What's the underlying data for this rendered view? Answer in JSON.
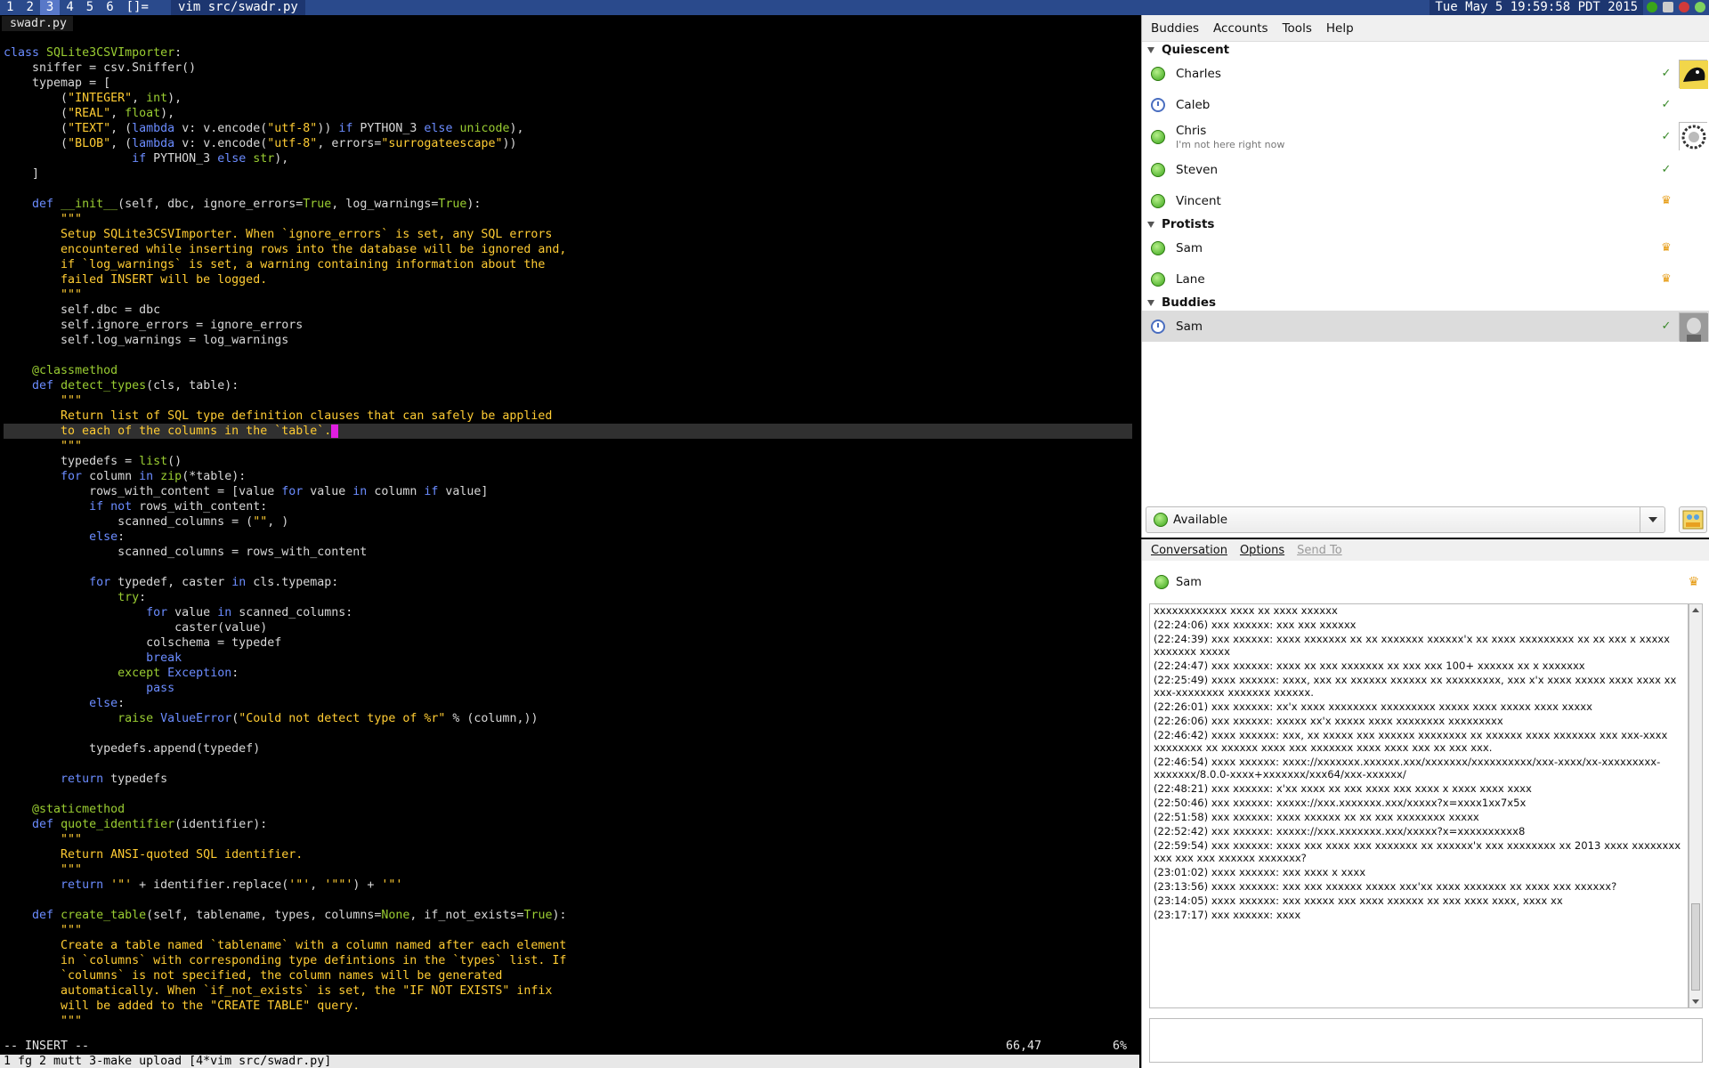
{
  "topbar": {
    "tags": [
      "1",
      "2",
      "3",
      "4",
      "5",
      "6",
      "[]="
    ],
    "active_tag": "3",
    "window_title": "vim src/swadr.py",
    "clock": "Tue May  5 19:59:58 PDT 2015"
  },
  "vim": {
    "filename": "swadr.py",
    "mode": "-- INSERT --",
    "position": "66,47",
    "percent": "6%",
    "tmux": "1 fg 2 mutt 3-make upload [4*vim src/swadr.py]",
    "cursor_line": 25,
    "lines": [
      [
        [
          "k",
          "class "
        ],
        [
          "b",
          "SQLite3CSVImporter"
        ],
        [
          "n",
          ":"
        ]
      ],
      [
        [
          "n",
          "    sniffer = csv.Sniffer()"
        ]
      ],
      [
        [
          "n",
          "    typemap = ["
        ]
      ],
      [
        [
          "n",
          "        ("
        ],
        [
          "s",
          "\"INTEGER\""
        ],
        [
          "n",
          ", "
        ],
        [
          "b",
          "int"
        ],
        [
          "n",
          "),"
        ]
      ],
      [
        [
          "n",
          "        ("
        ],
        [
          "s",
          "\"REAL\""
        ],
        [
          "n",
          ", "
        ],
        [
          "b",
          "float"
        ],
        [
          "n",
          "),"
        ]
      ],
      [
        [
          "n",
          "        ("
        ],
        [
          "s",
          "\"TEXT\""
        ],
        [
          "n",
          ", ("
        ],
        [
          "k",
          "lambda"
        ],
        [
          "n",
          " v: v.encode("
        ],
        [
          "s",
          "\"utf-8\""
        ],
        [
          "n",
          ")) "
        ],
        [
          "k",
          "if"
        ],
        [
          "n",
          " PYTHON_3 "
        ],
        [
          "k",
          "else"
        ],
        [
          "n",
          " "
        ],
        [
          "b",
          "unicode"
        ],
        [
          "n",
          "),"
        ]
      ],
      [
        [
          "n",
          "        ("
        ],
        [
          "s",
          "\"BLOB\""
        ],
        [
          "n",
          ", ("
        ],
        [
          "k",
          "lambda"
        ],
        [
          "n",
          " v: v.encode("
        ],
        [
          "s",
          "\"utf-8\""
        ],
        [
          "n",
          ", errors="
        ],
        [
          "s",
          "\"surrogateescape\""
        ],
        [
          "n",
          "))"
        ]
      ],
      [
        [
          "n",
          "                  "
        ],
        [
          "k",
          "if"
        ],
        [
          "n",
          " PYTHON_3 "
        ],
        [
          "k",
          "else"
        ],
        [
          "n",
          " "
        ],
        [
          "b",
          "str"
        ],
        [
          "n",
          "),"
        ]
      ],
      [
        [
          "n",
          "    ]"
        ]
      ],
      [
        [
          "n",
          ""
        ]
      ],
      [
        [
          "n",
          "    "
        ],
        [
          "k",
          "def"
        ],
        [
          "n",
          " "
        ],
        [
          "b",
          "__init__"
        ],
        [
          "n",
          "(self, dbc, ignore_errors="
        ],
        [
          "b",
          "True"
        ],
        [
          "n",
          ", log_warnings="
        ],
        [
          "b",
          "True"
        ],
        [
          "n",
          "):"
        ]
      ],
      [
        [
          "s",
          "        \"\"\""
        ]
      ],
      [
        [
          "s",
          "        Setup SQLite3CSVImporter. When `ignore_errors` is set, any SQL errors"
        ]
      ],
      [
        [
          "s",
          "        encountered while inserting rows into the database will be ignored and,"
        ]
      ],
      [
        [
          "s",
          "        if `log_warnings` is set, a warning containing information about the"
        ]
      ],
      [
        [
          "s",
          "        failed INSERT will be logged."
        ]
      ],
      [
        [
          "s",
          "        \"\"\""
        ]
      ],
      [
        [
          "n",
          "        self.dbc = dbc"
        ]
      ],
      [
        [
          "n",
          "        self.ignore_errors = ignore_errors"
        ]
      ],
      [
        [
          "n",
          "        self.log_warnings = log_warnings"
        ]
      ],
      [
        [
          "n",
          ""
        ]
      ],
      [
        [
          "n",
          "    "
        ],
        [
          "d",
          "@classmethod"
        ]
      ],
      [
        [
          "n",
          "    "
        ],
        [
          "k",
          "def"
        ],
        [
          "n",
          " "
        ],
        [
          "b",
          "detect_types"
        ],
        [
          "n",
          "(cls, table):"
        ]
      ],
      [
        [
          "s",
          "        \"\"\""
        ]
      ],
      [
        [
          "s",
          "        Return list of SQL type definition clauses that can safely be applied"
        ]
      ],
      [
        [
          "s",
          "        to each of the columns in the `table`."
        ]
      ],
      [
        [
          "s",
          "        \"\"\""
        ]
      ],
      [
        [
          "n",
          "        typedefs = "
        ],
        [
          "b",
          "list"
        ],
        [
          "n",
          "()"
        ]
      ],
      [
        [
          "n",
          "        "
        ],
        [
          "k",
          "for"
        ],
        [
          "n",
          " column "
        ],
        [
          "k",
          "in"
        ],
        [
          "n",
          " "
        ],
        [
          "b",
          "zip"
        ],
        [
          "n",
          "(*table):"
        ]
      ],
      [
        [
          "n",
          "            rows_with_content = [value "
        ],
        [
          "k",
          "for"
        ],
        [
          "n",
          " value "
        ],
        [
          "k",
          "in"
        ],
        [
          "n",
          " column "
        ],
        [
          "k",
          "if"
        ],
        [
          "n",
          " value]"
        ]
      ],
      [
        [
          "n",
          "            "
        ],
        [
          "k",
          "if not"
        ],
        [
          "n",
          " rows_with_content:"
        ]
      ],
      [
        [
          "n",
          "                scanned_columns = ("
        ],
        [
          "s",
          "\"\""
        ],
        [
          "n",
          ", )"
        ]
      ],
      [
        [
          "n",
          "            "
        ],
        [
          "k",
          "else"
        ],
        [
          "n",
          ":"
        ]
      ],
      [
        [
          "n",
          "                scanned_columns = rows_with_content"
        ]
      ],
      [
        [
          "n",
          ""
        ]
      ],
      [
        [
          "n",
          "            "
        ],
        [
          "k",
          "for"
        ],
        [
          "n",
          " typedef, caster "
        ],
        [
          "k",
          "in"
        ],
        [
          "n",
          " cls.typemap:"
        ]
      ],
      [
        [
          "n",
          "                "
        ],
        [
          "b",
          "try"
        ],
        [
          "n",
          ":"
        ]
      ],
      [
        [
          "n",
          "                    "
        ],
        [
          "k",
          "for"
        ],
        [
          "n",
          " value "
        ],
        [
          "k",
          "in"
        ],
        [
          "n",
          " scanned_columns:"
        ]
      ],
      [
        [
          "n",
          "                        caster(value)"
        ]
      ],
      [
        [
          "n",
          "                    colschema = typedef"
        ]
      ],
      [
        [
          "n",
          "                    "
        ],
        [
          "k",
          "break"
        ]
      ],
      [
        [
          "n",
          "                "
        ],
        [
          "b",
          "except"
        ],
        [
          "n",
          " "
        ],
        [
          "k",
          "Exception"
        ],
        [
          "n",
          ":"
        ]
      ],
      [
        [
          "n",
          "                    "
        ],
        [
          "k",
          "pass"
        ]
      ],
      [
        [
          "n",
          "            "
        ],
        [
          "k",
          "else"
        ],
        [
          "n",
          ":"
        ]
      ],
      [
        [
          "n",
          "                "
        ],
        [
          "b",
          "raise"
        ],
        [
          "n",
          " "
        ],
        [
          "k",
          "ValueError"
        ],
        [
          "n",
          "("
        ],
        [
          "s",
          "\"Could not detect type of %r\""
        ],
        [
          "n",
          " % (column,))"
        ]
      ],
      [
        [
          "n",
          ""
        ]
      ],
      [
        [
          "n",
          "            typedefs.append(typedef)"
        ]
      ],
      [
        [
          "n",
          ""
        ]
      ],
      [
        [
          "n",
          "        "
        ],
        [
          "k",
          "return"
        ],
        [
          "n",
          " typedefs"
        ]
      ],
      [
        [
          "n",
          ""
        ]
      ],
      [
        [
          "n",
          "    "
        ],
        [
          "d",
          "@staticmethod"
        ]
      ],
      [
        [
          "n",
          "    "
        ],
        [
          "k",
          "def"
        ],
        [
          "n",
          " "
        ],
        [
          "b",
          "quote_identifier"
        ],
        [
          "n",
          "(identifier):"
        ]
      ],
      [
        [
          "s",
          "        \"\"\""
        ]
      ],
      [
        [
          "s",
          "        Return ANSI-quoted SQL identifier."
        ]
      ],
      [
        [
          "s",
          "        \"\"\""
        ]
      ],
      [
        [
          "n",
          "        "
        ],
        [
          "k",
          "return"
        ],
        [
          "n",
          " "
        ],
        [
          "s",
          "'\"'"
        ],
        [
          "n",
          " + identifier.replace("
        ],
        [
          "s",
          "'\"'"
        ],
        [
          "n",
          ", "
        ],
        [
          "s",
          "'\"\"'"
        ],
        [
          "n",
          ") + "
        ],
        [
          "s",
          "'\"'"
        ]
      ],
      [
        [
          "n",
          ""
        ]
      ],
      [
        [
          "n",
          "    "
        ],
        [
          "k",
          "def"
        ],
        [
          "n",
          " "
        ],
        [
          "b",
          "create_table"
        ],
        [
          "n",
          "(self, tablename, types, columns="
        ],
        [
          "b",
          "None"
        ],
        [
          "n",
          ", if_not_exists="
        ],
        [
          "b",
          "True"
        ],
        [
          "n",
          "):"
        ]
      ],
      [
        [
          "s",
          "        \"\"\""
        ]
      ],
      [
        [
          "s",
          "        Create a table named `tablename` with a column named after each element"
        ]
      ],
      [
        [
          "s",
          "        in `columns` with corresponding type defintions in the `types` list. If"
        ]
      ],
      [
        [
          "s",
          "        `columns` is not specified, the column names will be generated"
        ]
      ],
      [
        [
          "s",
          "        automatically. When `if_not_exists` is set, the \"IF NOT EXISTS\" infix"
        ]
      ],
      [
        [
          "s",
          "        will be added to the \"CREATE TABLE\" query."
        ]
      ],
      [
        [
          "s",
          "        \"\"\""
        ]
      ]
    ]
  },
  "buddy_list": {
    "menu": [
      "Buddies",
      "Accounts",
      "Tools",
      "Help"
    ],
    "groups": [
      {
        "name": "Quiescent",
        "buddies": [
          {
            "name": "Charles",
            "status": "available",
            "protocol": "gtalk-icon",
            "avatar": "charles"
          },
          {
            "name": "Caleb",
            "status": "away",
            "protocol": "gtalk-icon",
            "avatar": ""
          },
          {
            "name": "Chris",
            "message": "I'm not here right now",
            "status": "available",
            "protocol": "gtalk-icon",
            "avatar": "chris"
          },
          {
            "name": "Steven",
            "status": "available",
            "protocol": "gtalk-icon",
            "avatar": ""
          },
          {
            "name": "Vincent",
            "status": "available",
            "protocol": "aim-icon",
            "avatar": ""
          }
        ]
      },
      {
        "name": "Protists",
        "buddies": [
          {
            "name": "Sam",
            "status": "available",
            "protocol": "aim-icon",
            "avatar": ""
          },
          {
            "name": "Lane",
            "status": "available",
            "protocol": "aim-icon",
            "avatar": ""
          }
        ]
      },
      {
        "name": "Buddies",
        "buddies": [
          {
            "name": "Sam",
            "status": "away",
            "protocol": "gtalk-icon",
            "avatar": "sam",
            "selected": true
          }
        ]
      }
    ],
    "status_selector": "Available"
  },
  "conversation": {
    "menu": [
      "Conversation",
      "Options",
      "Send To"
    ],
    "buddy": "Sam",
    "log": [
      {
        "time": "",
        "text": "xxxxxxxxxxxx xxxx xx xxxx xxxxxx"
      },
      {
        "time": "(22:24:06)",
        "text": "xxx xxxxxx: xxx xxx xxxxxx"
      },
      {
        "time": "(22:24:39)",
        "text": "xxx xxxxxx: xxxx xxxxxxx xx xx xxxxxxx xxxxxx'x xx xxxx xxxxxxxxx xx xx xxx x xxxxx xxxxxxx xxxxx"
      },
      {
        "time": "(22:24:47)",
        "text": "xxx xxxxxx: xxxx xx xxx xxxxxxx xx xxx xxx 100+ xxxxxx xx x xxxxxxx"
      },
      {
        "time": "(22:25:49)",
        "text": "xxxx xxxxxx: xxxx, xxx xx xxxxxx xxxxxx xx xxxxxxxxx, xxx x'x xxxx xxxxx xxxx xxxx xx xxx-xxxxxxxx xxxxxxx xxxxxx."
      },
      {
        "time": "(22:26:01)",
        "text": "xxx xxxxxx: xx'x xxxx xxxxxxxx xxxxxxxxx xxxxx xxxx xxxxx xxxx xxxxx"
      },
      {
        "time": "(22:26:06)",
        "text": "xxx xxxxxx: xxxxx xx'x xxxxx xxxx xxxxxxxx xxxxxxxxx"
      },
      {
        "time": "(22:46:42)",
        "text": "xxxx xxxxxx: xxx, xx xxxxx xxx xxxxxx xxxxxxxx xx xxxxxx xxxx xxxxxxx xxx xxx-xxxx xxxxxxxx xx xxxxxx xxxx xxx xxxxxxx xxxx xxxx xxx xx xxx xxx."
      },
      {
        "time": "(22:46:54)",
        "text": "xxxx xxxxxx: xxxx://xxxxxxx.xxxxxx.xxx/xxxxxxx/xxxxxxxxxx/xxx-xxxx/xx-xxxxxxxxx-xxxxxxx/8.0.0-xxxx+xxxxxxx/xxx64/xxx-xxxxxx/"
      },
      {
        "time": "(22:48:21)",
        "text": "xxx xxxxxx: x'xx xxxx xx xxx xxxx xxx xxxx x xxxx xxxx xxxx"
      },
      {
        "time": "(22:50:46)",
        "text": "xxx xxxxxx: xxxxx://xxx.xxxxxxx.xxx/xxxxx?x=xxxx1xx7x5x"
      },
      {
        "time": "(22:51:58)",
        "text": "xxx xxxxxx: xxxx xxxxxx xx xx xxx xxxxxxxx xxxxx"
      },
      {
        "time": "(22:52:42)",
        "text": "xxx xxxxxx: xxxxx://xxx.xxxxxxx.xxx/xxxxx?x=xxxxxxxxxx8"
      },
      {
        "time": "(22:59:54)",
        "text": "xxx xxxxxx: xxxx xxx xxxx xxx xxxxxxx xx xxxxxx'x xxx xxxxxxxx xx 2013 xxxx xxxxxxxx xxx xxx xxx xxxxxx xxxxxxx?"
      },
      {
        "time": "(23:01:02)",
        "text": "xxxx xxxxxx: xxx xxxx x xxxx"
      },
      {
        "time": "(23:13:56)",
        "text": "xxxx xxxxxx: xxx xxx xxxxxx xxxxx xxx'xx xxxx xxxxxxx xx xxxx xxx xxxxxx?"
      },
      {
        "time": "(23:14:05)",
        "text": "xxxx xxxxxx: xxx xxxxx xxx xxxx xxxxxx xx xxx xxxx xxxx, xxxx xx"
      },
      {
        "time": "(23:17:17)",
        "text": "xxx xxxxxx: xxxx"
      }
    ]
  },
  "colors": {
    "topbar": "#2a4a8c",
    "active_tag": "#5878c8",
    "keyword": "#6b8cff",
    "builtin": "#9acd32",
    "string": "#ffcc33",
    "cursor": "#e01ee0"
  }
}
